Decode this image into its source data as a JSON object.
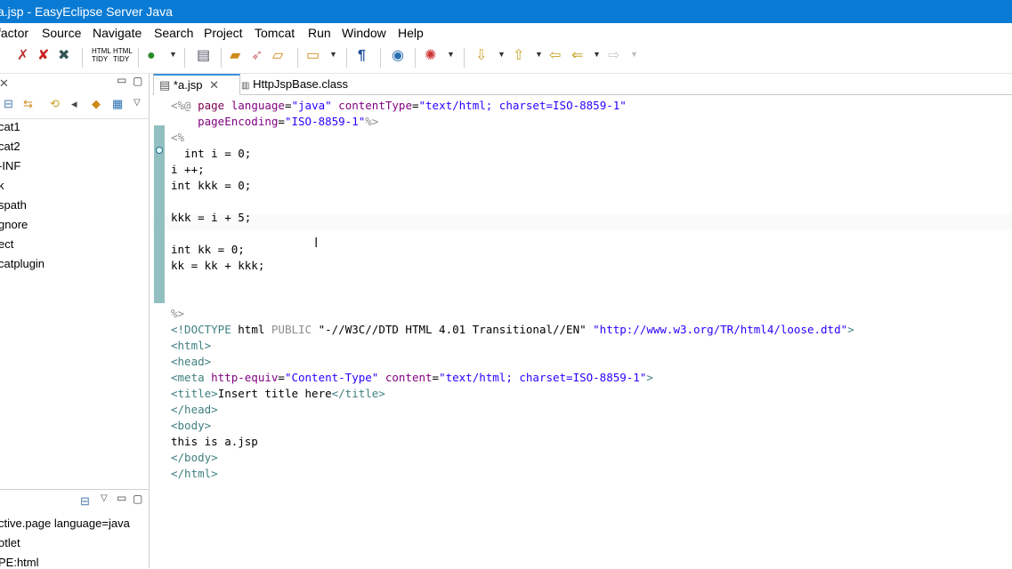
{
  "window": {
    "title": "a.jsp - EasyEclipse Server Java"
  },
  "menu": [
    "factor",
    "Source",
    "Navigate",
    "Search",
    "Project",
    "Tomcat",
    "Run",
    "Window",
    "Help"
  ],
  "toolbar_icons": [
    "bug-icon",
    "bug-alt-icon",
    "debug-icon",
    "html-tidy-icon",
    "html-tidy-alt-icon",
    "run-icon",
    "page-icon",
    "open-folder-icon",
    "rocket-icon",
    "folder-open-icon",
    "new-folder-icon",
    "pilcrow-icon",
    "globe-icon",
    "spinner-icon",
    "arrow-down-icon",
    "arrow-up-icon",
    "back-icon",
    "back-alt-icon",
    "forward-icon"
  ],
  "left": {
    "tree_items": [
      "cat1",
      "cat2",
      "-INF",
      "k",
      "spath",
      "gnore",
      "ect",
      "catplugin"
    ],
    "outline_items": [
      "ctive.page language=java",
      "otlet",
      "PE:html"
    ]
  },
  "tabs": [
    {
      "label": "*a.jsp",
      "active": true
    },
    {
      "label": "HttpJspBase.class",
      "active": false
    }
  ],
  "code": {
    "l1a": "<%@ ",
    "l1b": "page ",
    "l1c": "language",
    "l1d": "=",
    "l1e": "\"java\"",
    "l1f": " contentType",
    "l1g": "=",
    "l1h": "\"text/html; charset=ISO-8859-1\"",
    "l2a": "    pageEncoding",
    "l2b": "=",
    "l2c": "\"ISO-8859-1\"",
    "l2d": "%>",
    "l3": "<%",
    "l4": "  int i = 0;",
    "l5": "i ++;",
    "l6": "int kkk = 0;",
    "l8": "kkk = i + 5;",
    "l10": "int kk = 0;",
    "l11": "kk = kk + kkk;",
    "l14": "%>",
    "l15a": "<!DOCTYPE ",
    "l15b": "html ",
    "l15c": "PUBLIC ",
    "l15d": "\"-//W3C//DTD HTML 4.01 Transitional//EN\"",
    "l15e": " \"http://www.w3.org/TR/html4/loose.dtd\"",
    "l15f": ">",
    "l16": "<html>",
    "l17": "<head>",
    "l18a": "<meta ",
    "l18b": "http-equiv",
    "l18c": "=",
    "l18d": "\"Content-Type\"",
    "l18e": " content",
    "l18f": "=",
    "l18g": "\"text/html; charset=ISO-8859-1\"",
    "l18h": ">",
    "l19a": "<title>",
    "l19b": "Insert title here",
    "l19c": "</title>",
    "l20": "</head>",
    "l21": "<body>",
    "l22": "this is a.jsp",
    "l23": "</body>",
    "l24": "</html>"
  }
}
